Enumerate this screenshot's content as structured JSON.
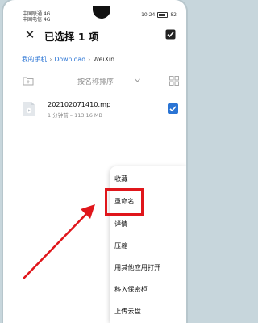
{
  "status_bar": {
    "carrier_1": "中国联通 4G",
    "carrier_2": "中国电信 4G",
    "time": "10:24",
    "battery": "82"
  },
  "header": {
    "title": "已选择 1 项",
    "close_icon": "close-icon",
    "select_all_icon": "select-all-icon"
  },
  "breadcrumb": {
    "items": [
      "我的手机",
      "Download",
      "WeiXin"
    ]
  },
  "toolbar": {
    "sort_label": "按名称排序",
    "new_folder_icon": "new-folder-icon",
    "grid_view_icon": "grid-view-icon"
  },
  "file": {
    "name": "202102071410.mp",
    "meta": "1 分钟前 – 113.16 MB",
    "selected": true
  },
  "menu": {
    "items": [
      "收藏",
      "重命名",
      "详情",
      "压缩",
      "用其他应用打开",
      "移入保密柜",
      "上传云盘"
    ],
    "highlighted_index": 1
  },
  "colors": {
    "accent": "#2a74d4",
    "highlight": "#e0161b",
    "background": "#c7d6dc"
  }
}
